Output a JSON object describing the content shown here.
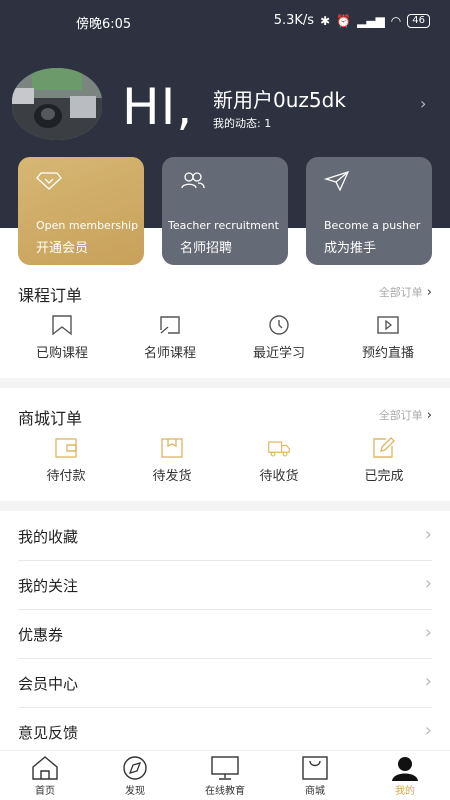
{
  "status": {
    "time": "傍晚6:05",
    "speed": "5.3K/s",
    "battery": "46"
  },
  "profile": {
    "greeting": "HI,",
    "username": "新用户0uz5dk",
    "dynamics": "我的动态: 1"
  },
  "cards": [
    {
      "en": "Open membership",
      "cn": "开通会员",
      "icon": "diamond-icon"
    },
    {
      "en": "Teacher recruitment",
      "cn": "名师招聘",
      "icon": "users-icon"
    },
    {
      "en": "Become a pusher",
      "cn": "成为推手",
      "icon": "send-icon"
    }
  ],
  "course_orders": {
    "title": "课程订单",
    "all": "全部订单",
    "items": [
      {
        "label": "已购课程",
        "icon": "bookmark-icon"
      },
      {
        "label": "名师课程",
        "icon": "teacher-board-icon"
      },
      {
        "label": "最近学习",
        "icon": "clock-icon"
      },
      {
        "label": "预约直播",
        "icon": "play-icon"
      }
    ]
  },
  "mall_orders": {
    "title": "商城订单",
    "all": "全部订单",
    "items": [
      {
        "label": "待付款",
        "icon": "wallet-icon"
      },
      {
        "label": "待发货",
        "icon": "box-icon"
      },
      {
        "label": "待收货",
        "icon": "truck-icon"
      },
      {
        "label": "已完成",
        "icon": "edit-icon"
      }
    ],
    "accent": "#e8c07a"
  },
  "menu": [
    {
      "label": "我的收藏"
    },
    {
      "label": "我的关注"
    },
    {
      "label": "优惠券"
    },
    {
      "label": "会员中心"
    },
    {
      "label": "意见反馈"
    }
  ],
  "tabbar": [
    {
      "label": "首页",
      "icon": "home-icon"
    },
    {
      "label": "发现",
      "icon": "compass-icon"
    },
    {
      "label": "在线教育",
      "icon": "monitor-icon"
    },
    {
      "label": "商城",
      "icon": "shopping-bag-icon"
    },
    {
      "label": "我的",
      "icon": "person-icon",
      "active": true
    }
  ],
  "colors": {
    "header_bg": "#2e3240",
    "gold": "#d4a94e",
    "card_gray": "#646a76"
  }
}
